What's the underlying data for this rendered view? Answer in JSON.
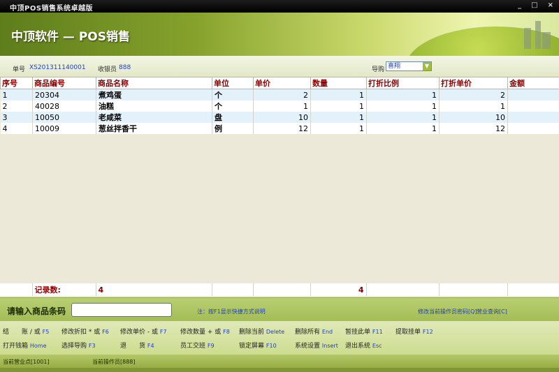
{
  "window": {
    "title": "中顶POS销售系统卓越版",
    "controls": [
      "_",
      "□",
      "×"
    ]
  },
  "banner": {
    "logo_text": "中顶软件 — POS销售"
  },
  "info": {
    "order_no_label": "单号",
    "order_no": "XS201311140001",
    "cashier_label": "收银员",
    "cashier": "888",
    "guide_label": "导购",
    "guide_value": "喜翔"
  },
  "table": {
    "columns": [
      "序号",
      "商品编号",
      "商品名称",
      "单位",
      "单价",
      "数量",
      "打折比例",
      "打折单价",
      "金额"
    ],
    "rows": [
      [
        "1",
        "20304",
        "煮鸡蛋",
        "个",
        "2",
        "1",
        "1",
        "2"
      ],
      [
        "2",
        "40028",
        "油糕",
        "个",
        "1",
        "1",
        "1",
        "1"
      ],
      [
        "3",
        "10050",
        "老咸菜",
        "盘",
        "10",
        "1",
        "1",
        "10"
      ],
      [
        "4",
        "10009",
        "葱丝拌香干",
        "例",
        "12",
        "1",
        "1",
        "12"
      ]
    ],
    "footer": {
      "label": "记录数:",
      "count": "4",
      "qty_total": "4"
    }
  },
  "inputbar": {
    "label": "请输入商品条码",
    "value": "",
    "tip": "注：按F1显示快捷方式说明",
    "link_password": "修改当前操作员密码[Q]",
    "link_query": "营业查询[C]"
  },
  "shortcuts": {
    "row1": [
      {
        "label": "结　　账 / 或",
        "key": "F5"
      },
      {
        "label": "修改折扣 * 或",
        "key": "F6"
      },
      {
        "label": "修改单价 - 或",
        "key": "F7"
      },
      {
        "label": "修改数量 + 或",
        "key": "F8"
      },
      {
        "label": "删除当前",
        "key": "Delete"
      },
      {
        "label": "删除所有",
        "key": "End"
      },
      {
        "label": "暂挂此单",
        "key": "F11"
      },
      {
        "label": "提取挂单",
        "key": "F12"
      }
    ],
    "row2": [
      {
        "label": "打开钱箱",
        "key": "Home"
      },
      {
        "label": "选择导购",
        "key": "F3"
      },
      {
        "label": "退　　货",
        "key": "F4"
      },
      {
        "label": "员工交班",
        "key": "F9"
      },
      {
        "label": "锁定屏幕",
        "key": "F10"
      },
      {
        "label": "系统设置",
        "key": "Insert"
      },
      {
        "label": "退出系统",
        "key": "Esc"
      }
    ]
  },
  "status": {
    "store": "当前营业点[1001]",
    "operator": "当前操作员[888]"
  }
}
